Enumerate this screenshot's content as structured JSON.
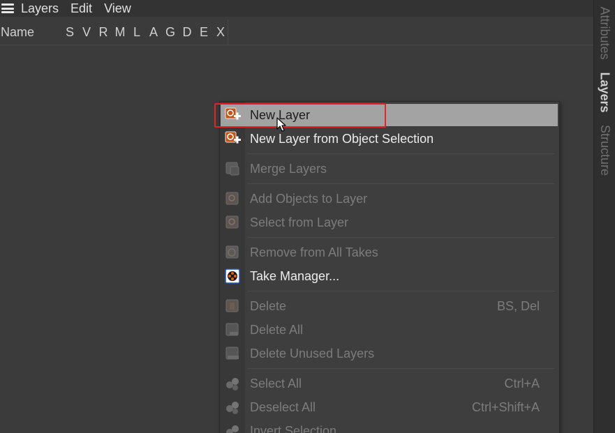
{
  "menubar": {
    "items": [
      "Layers",
      "Edit",
      "View"
    ]
  },
  "columns": {
    "name": "Name",
    "flags": [
      "S",
      "V",
      "R",
      "M",
      "L",
      "A",
      "G",
      "D",
      "E",
      "X"
    ]
  },
  "side_tabs": [
    {
      "label": "Attributes",
      "active": false
    },
    {
      "label": "Layers",
      "active": true
    },
    {
      "label": "Structure",
      "active": false
    }
  ],
  "context_menu": {
    "items": [
      {
        "label": "New Layer",
        "shortcut": "",
        "enabled": true,
        "icon": "new-layer-icon",
        "hovered": true
      },
      {
        "label": "New Layer from Object Selection",
        "shortcut": "",
        "enabled": true,
        "icon": "new-layer-from-selection-icon"
      },
      {
        "label": "Merge Layers",
        "shortcut": "",
        "enabled": false,
        "icon": "merge-layers-icon"
      },
      {
        "label": "Add Objects to Layer",
        "shortcut": "",
        "enabled": false,
        "icon": "add-objects-icon"
      },
      {
        "label": "Select from Layer",
        "shortcut": "",
        "enabled": false,
        "icon": "select-from-layer-icon"
      },
      {
        "label": "Remove from All Takes",
        "shortcut": "",
        "enabled": false,
        "icon": "remove-from-takes-icon"
      },
      {
        "label": "Take Manager...",
        "shortcut": "",
        "enabled": true,
        "icon": "take-manager-icon"
      },
      {
        "label": "Delete",
        "shortcut": "BS, Del",
        "enabled": false,
        "icon": "delete-icon"
      },
      {
        "label": "Delete All",
        "shortcut": "",
        "enabled": false,
        "icon": "delete-all-icon"
      },
      {
        "label": "Delete Unused Layers",
        "shortcut": "",
        "enabled": false,
        "icon": "delete-unused-icon"
      },
      {
        "label": "Select All",
        "shortcut": "Ctrl+A",
        "enabled": false,
        "icon": "select-all-icon"
      },
      {
        "label": "Deselect All",
        "shortcut": "Ctrl+Shift+A",
        "enabled": false,
        "icon": "deselect-all-icon"
      },
      {
        "label": "Invert Selection",
        "shortcut": "",
        "enabled": false,
        "icon": "invert-selection-icon"
      }
    ]
  },
  "colors": {
    "highlight_box": "#e0242a",
    "hover_bg": "#a3a3a3",
    "icon_orange": "#d9641e"
  }
}
